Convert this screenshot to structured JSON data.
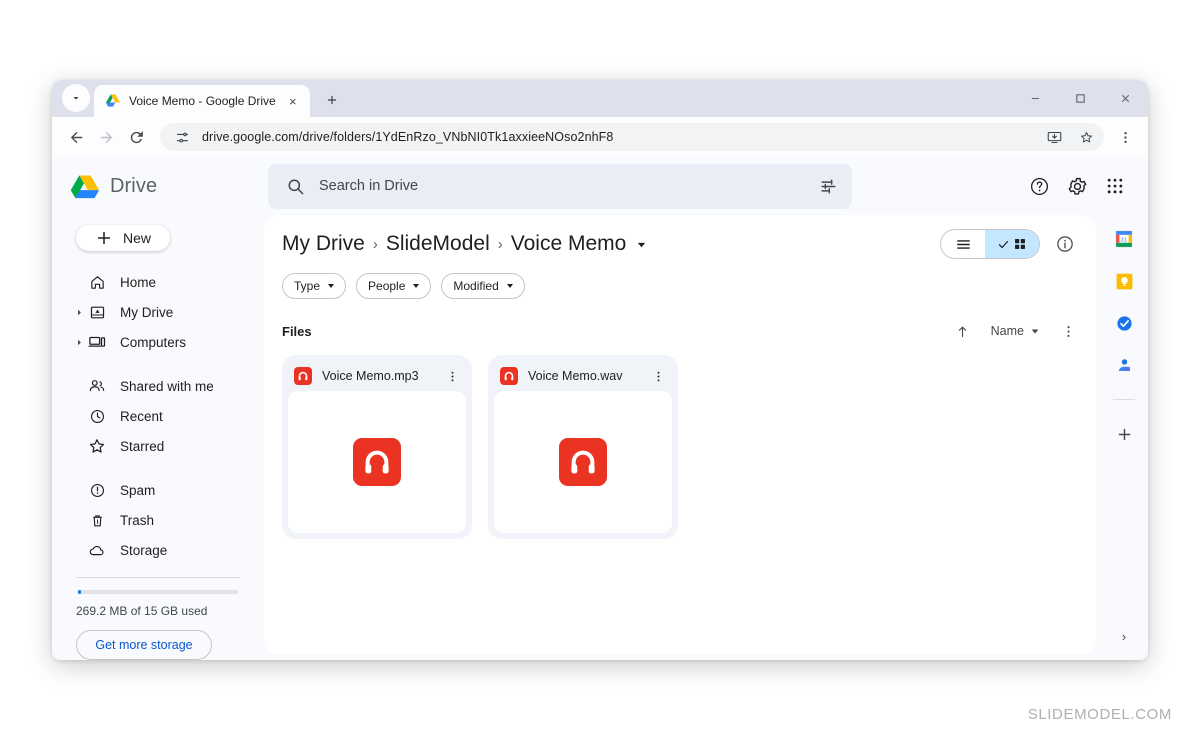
{
  "browser": {
    "tab": {
      "title": "Voice Memo - Google Drive",
      "favicon": "google-drive-icon",
      "close": "×"
    },
    "new_tab_label": "+",
    "window_controls": {
      "minimize": "–",
      "maximize": "□",
      "close": "×"
    },
    "nav": {
      "back": "←",
      "forward": "→",
      "reload": "↻"
    },
    "url": "drive.google.com/drive/folders/1YdEnRzo_VNbNI0Tk1axxieeNOso2nhF8",
    "omnibox_icons": [
      "site-settings-icon",
      "install-app-icon",
      "bookmark-star-icon"
    ],
    "menu_icon": "three-dot-menu-icon"
  },
  "header": {
    "brand": "Drive",
    "brand_icon": "google-drive-logo",
    "search": {
      "placeholder": "Search in Drive",
      "value": "",
      "search_icon": "search-icon",
      "options_icon": "tune-icon"
    },
    "actions": [
      {
        "name": "help-icon",
        "label": "Help"
      },
      {
        "name": "settings-icon",
        "label": "Settings"
      },
      {
        "name": "apps-grid-icon",
        "label": "Google apps"
      }
    ]
  },
  "sidebar": {
    "new_button": {
      "label": "New",
      "icon": "plus-icon"
    },
    "groups": [
      {
        "items": [
          {
            "label": "Home",
            "icon": "home-icon",
            "expandable": false
          },
          {
            "label": "My Drive",
            "icon": "my-drive-icon",
            "expandable": true
          },
          {
            "label": "Computers",
            "icon": "computers-icon",
            "expandable": true
          }
        ]
      },
      {
        "items": [
          {
            "label": "Shared with me",
            "icon": "shared-people-icon",
            "expandable": false
          },
          {
            "label": "Recent",
            "icon": "clock-icon",
            "expandable": false
          },
          {
            "label": "Starred",
            "icon": "star-icon",
            "expandable": false
          }
        ]
      },
      {
        "items": [
          {
            "label": "Spam",
            "icon": "spam-icon",
            "expandable": false
          },
          {
            "label": "Trash",
            "icon": "trash-icon",
            "expandable": false
          },
          {
            "label": "Storage",
            "icon": "cloud-icon",
            "expandable": false
          }
        ]
      }
    ],
    "storage": {
      "used_text": "269.2 MB of 15 GB used",
      "percent": 1.8,
      "button_label": "Get more storage",
      "bar_color": "#1a73e8"
    }
  },
  "main": {
    "breadcrumb": [
      {
        "label": "My Drive"
      },
      {
        "label": "SlideModel"
      },
      {
        "label": "Voice Memo"
      }
    ],
    "breadcrumb_separator": "›",
    "view_toggle": {
      "list": {
        "name": "list-view",
        "active": false
      },
      "grid": {
        "name": "grid-view",
        "active": true
      }
    },
    "info_icon": "info-icon",
    "filters": [
      {
        "label": "Type"
      },
      {
        "label": "People"
      },
      {
        "label": "Modified"
      }
    ],
    "section_title": "Files",
    "sort": {
      "direction_icon": "sort-ascending-arrow-icon",
      "field_label": "Name",
      "more_icon": "list-options-icon"
    },
    "files": [
      {
        "name": "Voice Memo.mp3",
        "icon": "audio-file-icon",
        "icon_color": "#ea3323",
        "more_icon": "more-options-icon"
      },
      {
        "name": "Voice Memo.wav",
        "icon": "audio-file-icon",
        "icon_color": "#ea3323",
        "more_icon": "more-options-icon"
      }
    ]
  },
  "right_rail": {
    "icons": [
      {
        "name": "google-calendar-icon",
        "label": "Calendar"
      },
      {
        "name": "google-keep-icon",
        "label": "Keep"
      },
      {
        "name": "google-tasks-icon",
        "label": "Tasks"
      },
      {
        "name": "google-contacts-icon",
        "label": "Contacts"
      }
    ],
    "add_label": "+",
    "expand_chevron": "›"
  },
  "watermark": "SLIDEMODEL.COM"
}
